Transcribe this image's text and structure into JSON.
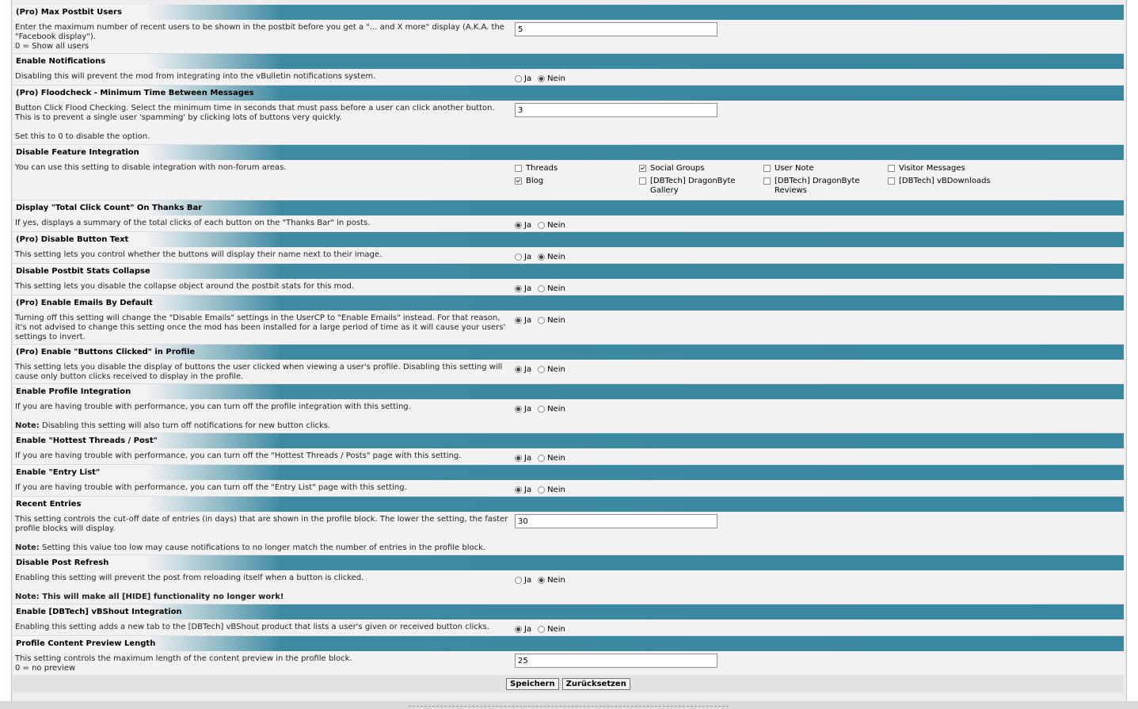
{
  "radio_labels": {
    "yes": "Ja",
    "no": "Nein"
  },
  "colors": {
    "header": "#3a87a1",
    "row": "#f2f2f2",
    "frame": "#ececec"
  },
  "settings": [
    {
      "title": "(Pro) Max Postbit Users",
      "desc": "Enter the maximum number of recent users to be shown in the postbit before you get a \"... and X more\" display (A.K.A. the \"Facebook display\").",
      "desc2": "0 = Show all users",
      "value": "5"
    },
    {
      "title": "Enable Notifications",
      "desc": "Disabling this will prevent the mod from integrating into the vBulletin notifications system.",
      "selected": "Nein"
    },
    {
      "title": "(Pro) Floodcheck - Minimum Time Between Messages",
      "desc": "Button Click Flood Checking. Select the minimum time in seconds that must pass before a user can click another button. This is to prevent a single user 'spamming' by clicking lots of buttons very quickly.",
      "note": "Set this to 0 to disable the option.",
      "value": "3"
    },
    {
      "title": "Disable Feature Integration",
      "desc": "You can use this setting to disable integration with non-forum areas.",
      "options": [
        {
          "label": "Threads",
          "checked": false
        },
        {
          "label": "Social Groups",
          "checked": true
        },
        {
          "label": "User Note",
          "checked": false
        },
        {
          "label": "Visitor Messages",
          "checked": false
        },
        {
          "label": "Blog",
          "checked": true
        },
        {
          "label": "[DBTech] DragonByte Gallery",
          "checked": false
        },
        {
          "label": "[DBTech] DragonByte Reviews",
          "checked": false
        },
        {
          "label": "[DBTech] vBDownloads",
          "checked": false
        }
      ]
    },
    {
      "title": "Display \"Total Click Count\" On Thanks Bar",
      "desc": "If yes, displays a summary of the total clicks of each button on the \"Thanks Bar\" in posts.",
      "selected": "Ja"
    },
    {
      "title": "(Pro) Disable Button Text",
      "desc": "This setting lets you control whether the buttons will display their name next to their image.",
      "selected": "Nein"
    },
    {
      "title": "Disable Postbit Stats Collapse",
      "desc": "This setting lets you disable the collapse object around the postbit stats for this mod.",
      "selected": "Ja"
    },
    {
      "title": "(Pro) Enable Emails By Default",
      "desc": "Turning off this setting will change the \"Disable Emails\" settings in the UserCP to \"Enable Emails\" instead. For that reason, it's not advised to change this setting once the mod has been installed for a large period of time as it will cause your users' settings to invert.",
      "selected": "Ja"
    },
    {
      "title": "(Pro) Enable \"Buttons Clicked\" in Profile",
      "desc": "This setting lets you disable the display of buttons the user clicked when viewing a user's profile. Disabling this setting will cause only button clicks received to display in the profile.",
      "selected": "Ja"
    },
    {
      "title": "Enable Profile Integration",
      "desc": "If you are having trouble with performance, you can turn off the profile integration with this setting.",
      "note_label": "Note:",
      "note_text": " Disabling this setting will also turn off notifications for new button clicks.",
      "selected": "Ja"
    },
    {
      "title": "Enable \"Hottest Threads / Post\"",
      "desc": "If you are having trouble with performance, you can turn off the \"Hottest Threads / Posts\" page with this setting.",
      "selected": "Ja"
    },
    {
      "title": "Enable \"Entry List\"",
      "desc": "If you are having trouble with performance, you can turn off the \"Entry List\" page with this setting.",
      "selected": "Ja"
    },
    {
      "title": "Recent Entries",
      "desc": "This setting controls the cut-off date of entries (in days) that are shown in the profile block. The lower the setting, the faster profile blocks will display.",
      "note_label": "Note:",
      "note_text": " Setting this value too low may cause notifications to no longer match the number of entries in the profile block.",
      "value": "30"
    },
    {
      "title": "Disable Post Refresh",
      "desc": "Enabling this setting will prevent the post from reloading itself when a button is clicked.",
      "note_label": "Note: This will make all [HIDE] functionality no longer work!",
      "note_text": "",
      "selected": "Nein"
    },
    {
      "title": "Enable [DBTech] vBShout Integration",
      "desc": "Enabling this setting adds a new tab to the [DBTech] vBShout product that lists a user's given or received button clicks.",
      "selected": "Ja"
    },
    {
      "title": "Profile Content Preview Length",
      "desc": "This setting controls the maximum length of the content preview in the profile block.",
      "desc2": "0 = no preview",
      "value": "25"
    }
  ],
  "buttons": {
    "save": "Speichern",
    "reset": "Zurücksetzen"
  }
}
